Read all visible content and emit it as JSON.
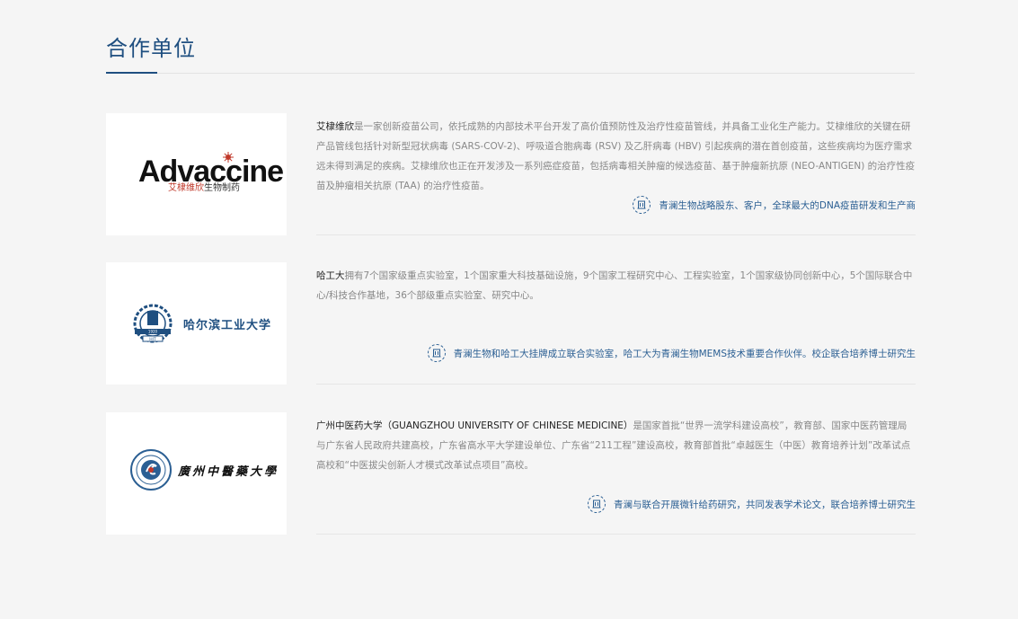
{
  "section": {
    "title": "合作单位"
  },
  "partners": [
    {
      "logo": {
        "brand": "Advaccine",
        "brand_cn_red": "艾棣维欣",
        "brand_cn_black": "生物制药"
      },
      "name": "艾棣维欣",
      "description": "是一家创新疫苗公司，依托成熟的内部技术平台开发了高价值预防性及治疗性疫苗管线，并具备工业化生产能力。艾棣维欣的关键在研产品管线包括针对新型冠状病毒 (SARS-COV-2)、呼吸道合胞病毒 (RSV) 及乙肝病毒 (HBV) 引起疾病的潜在首创疫苗，这些疾病均为医疗需求远未得到满足的疾病。艾棣维欣也正在开发涉及一系列癌症疫苗，包括病毒相关肿瘤的候选疫苗、基于肿瘤新抗原 (NEO-ANTIGEN) 的治疗性疫苗及肿瘤相关抗原 (TAA) 的治疗性疫苗。",
      "highlight": "青澜生物战略股东、客户，全球最大的DNA疫苗研发和生产商",
      "highlight_icon": "building-icon"
    },
    {
      "logo": {
        "brand": "哈尔滨工业大学",
        "year": "1920",
        "abbr": "HIT"
      },
      "name": "哈工大",
      "description": "拥有7个国家级重点实验室，1个国家重大科技基础设施，9个国家工程研究中心、工程实验室，1个国家级协同创新中心，5个国际联合中心/科技合作基地，36个部级重点实验室、研究中心。",
      "highlight": "青澜生物和哈工大挂牌成立联合实验室，哈工大为青澜生物MEMS技术重要合作伙伴。校企联合培养博士研究生",
      "highlight_icon": "building-icon"
    },
    {
      "logo": {
        "brand": "廣州中醫藥大學"
      },
      "name": "广州中医药大学（GUANGZHOU UNIVERSITY OF CHINESE MEDICINE）",
      "description": "是国家首批“世界一流学科建设高校”，教育部、国家中医药管理局与广东省人民政府共建高校，广东省高水平大学建设单位、广东省“211工程”建设高校，教育部首批“卓越医生（中医）教育培养计划”改革试点高校和“中医拔尖创新人才模式改革试点项目”高校。",
      "highlight": "青澜与联合开展微针给药研究，共同发表学术论文，联合培养博士研究生",
      "highlight_icon": "building-icon"
    }
  ],
  "colors": {
    "accent": "#1f4f80",
    "background": "#f5f5f5",
    "text_muted": "#888888",
    "logo_red": "#c0392b"
  }
}
